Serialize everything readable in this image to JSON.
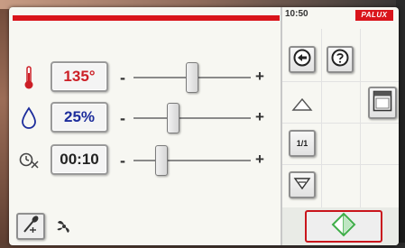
{
  "status": {
    "time": "10:50",
    "brand": "PALUX"
  },
  "controls": {
    "temperature": {
      "value": "135°",
      "icon": "thermometer-icon",
      "minus": "-",
      "plus": "+"
    },
    "humidity": {
      "value": "25%",
      "icon": "droplet-icon",
      "minus": "-",
      "plus": "+"
    },
    "timer": {
      "value": "00:10",
      "icon": "timer-icon",
      "minus": "-",
      "plus": "+"
    }
  },
  "navigation": {
    "page_indicator": "1/1"
  },
  "icons": {
    "back": "back-arrow-icon",
    "help": "help-icon",
    "door": "oven-door-icon",
    "up": "up-arrow-icon",
    "down": "down-arrow-icon",
    "probe": "core-probe-icon",
    "fan": "fan-icon",
    "start": "start-diamond-icon"
  },
  "colors": {
    "accent_red": "#d9141b",
    "temperature_text": "#cc1f26",
    "humidity_text": "#1d2d9c",
    "start_green": "#3fae49"
  }
}
